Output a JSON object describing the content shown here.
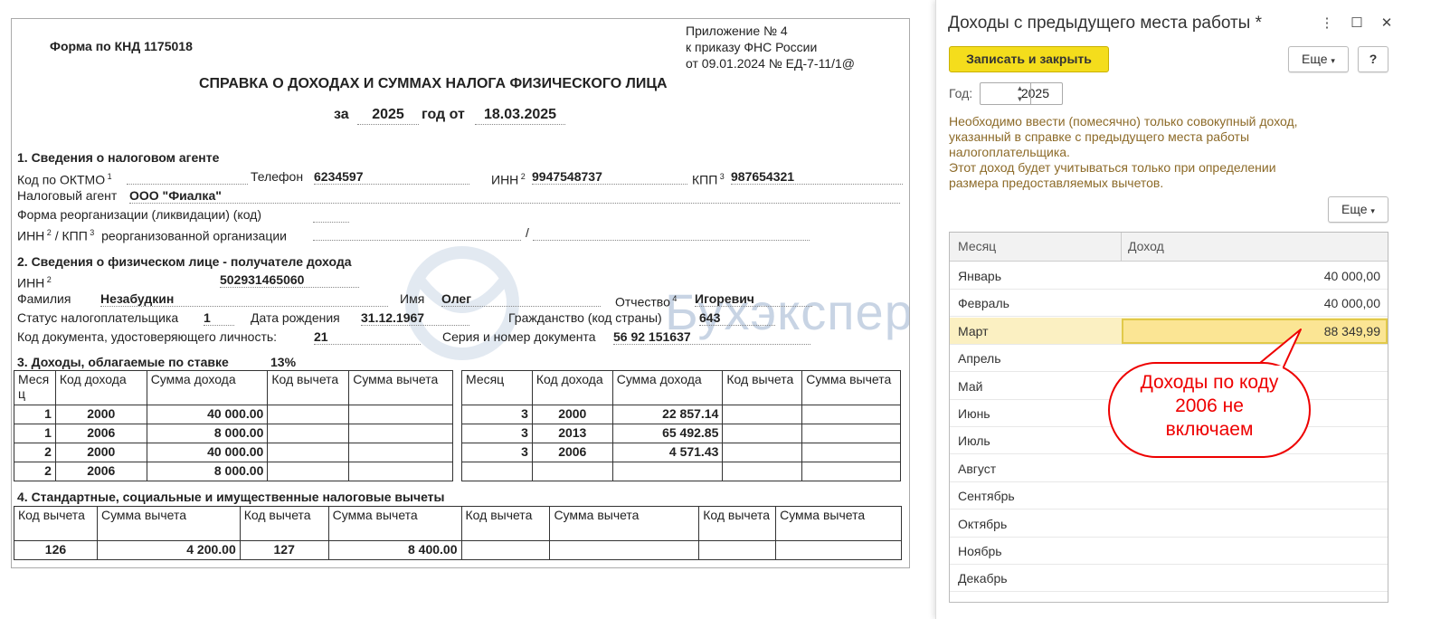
{
  "document": {
    "form_code": "Форма по КНД 1175018",
    "appendix": [
      "Приложение № 4",
      "к приказу ФНС России",
      "от 09.01.2024 № ЕД-7-11/1@"
    ],
    "title": "СПРАВКА О ДОХОДАХ И СУММАХ НАЛОГА ФИЗИЧЕСКОГО ЛИЦА",
    "for_label": "за",
    "year": "2025",
    "year_from_label": "год от",
    "date": "18.03.2025",
    "s1": {
      "title": "1. Сведения о налоговом агенте",
      "oktmo_label": "Код по ОКТМО",
      "phone_label": "Телефон",
      "phone": "6234597",
      "inn_label": "ИНН",
      "inn": "9947548737",
      "kpp_label": "КПП",
      "kpp": "987654321",
      "agent_label": "Налоговый агент",
      "agent": "ООО \"Фиалка\"",
      "reorg_label": "Форма реорганизации (ликвидации)  (код)",
      "inn_kpp_label": "ИНН",
      "kpp_sep": "/ КПП",
      "reorg_org_label": "реорганизованной организации",
      "slash": "/"
    },
    "s2": {
      "title": "2. Сведения о физическом лице - получателе дохода",
      "inn_label": "ИНН",
      "inn": "502931465060",
      "surname_label": "Фамилия",
      "surname": "Незабудкин",
      "name_label": "Имя",
      "name": "Олег",
      "patronymic_label": "Отчество",
      "patronymic": "Игоревич",
      "status_label": "Статус налогоплательщика",
      "status": "1",
      "birth_label": "Дата рождения",
      "birth": "31.12.1967",
      "citizenship_label": "Гражданство (код страны)",
      "citizenship": "643",
      "doc_code_label": "Код документа, удостоверяющего личность:",
      "doc_code": "21",
      "doc_num_label": "Серия и номер документа",
      "doc_num": "56 92 151637"
    },
    "s3": {
      "title": "3. Доходы, облагаемые по ставке",
      "rate": "13%",
      "headers": [
        "Меся ц",
        "Код дохода",
        "Сумма дохода",
        "Код вычета",
        "Сумма вычета"
      ],
      "headers_right": [
        "Месяц",
        "Код дохода",
        "Сумма дохода",
        "Код вычета",
        "Сумма вычета"
      ],
      "left_rows": [
        [
          "1",
          "2000",
          "40 000.00",
          "",
          ""
        ],
        [
          "1",
          "2006",
          "8 000.00",
          "",
          ""
        ],
        [
          "2",
          "2000",
          "40 000.00",
          "",
          ""
        ],
        [
          "2",
          "2006",
          "8 000.00",
          "",
          ""
        ]
      ],
      "right_rows": [
        [
          "3",
          "2000",
          "22 857.14",
          "",
          ""
        ],
        [
          "3",
          "2013",
          "65 492.85",
          "",
          ""
        ],
        [
          "3",
          "2006",
          "4 571.43",
          "",
          ""
        ],
        [
          "",
          "",
          "",
          "",
          ""
        ]
      ]
    },
    "s4": {
      "title": "4. Стандартные, социальные и имущественные налоговые вычеты",
      "headers": [
        "Код вычета",
        "Сумма вычета",
        "Код вычета",
        "Сумма вычета",
        "Код вычета",
        "Сумма вычета",
        "Код вычета",
        "Сумма вычета"
      ],
      "row": [
        "126",
        "4 200.00",
        "127",
        "8 400.00",
        "",
        "",
        "",
        ""
      ]
    },
    "watermark": "Бухэксперт"
  },
  "form": {
    "title": "Доходы с предыдущего места работы *",
    "save_close": "Записать и закрыть",
    "more": "Еще",
    "help": "?",
    "year_label": "Год:",
    "year": "2025",
    "info": [
      "Необходимо ввести (помесячно) только совокупный доход,",
      "указанный в справке с предыдущего места работы",
      "налогоплательщика.",
      "Этот доход будет учитываться только при определении",
      "размера предоставляемых вычетов."
    ],
    "table_more": "Еще",
    "col_month": "Месяц",
    "col_income": "Доход",
    "rows": [
      {
        "month": "Январь",
        "income": "40 000,00"
      },
      {
        "month": "Февраль",
        "income": "40 000,00"
      },
      {
        "month": "Март",
        "income": "88 349,99"
      },
      {
        "month": "Апрель",
        "income": ""
      },
      {
        "month": "Май",
        "income": ""
      },
      {
        "month": "Июнь",
        "income": ""
      },
      {
        "month": "Июль",
        "income": ""
      },
      {
        "month": "Август",
        "income": ""
      },
      {
        "month": "Сентябрь",
        "income": ""
      },
      {
        "month": "Октябрь",
        "income": ""
      },
      {
        "month": "Ноябрь",
        "income": ""
      },
      {
        "month": "Декабрь",
        "income": ""
      }
    ],
    "callout": [
      "Доходы по коду",
      "2006 не",
      "включаем"
    ]
  }
}
